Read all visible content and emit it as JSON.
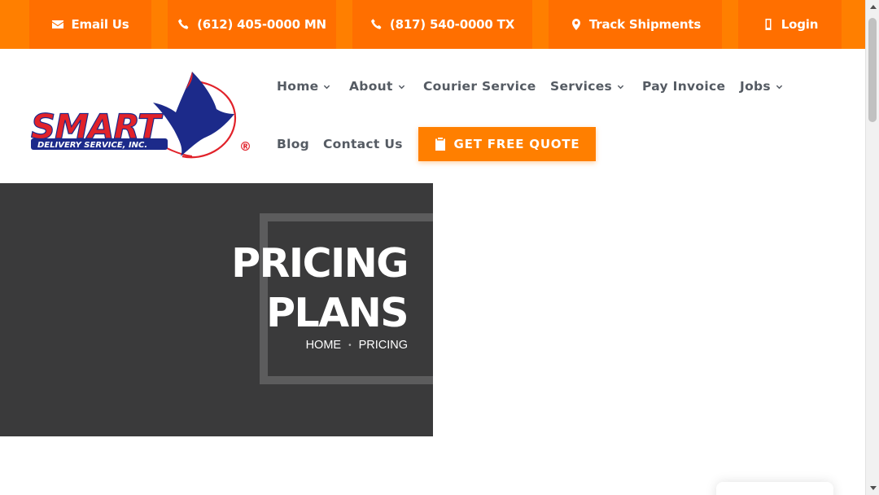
{
  "topbar": {
    "email_label": "Email Us",
    "phone_mn_label": "(612) 405-0000 MN",
    "phone_tx_label": "(817) 540-0000 TX",
    "track_label": "Track Shipments",
    "login_label": "Login"
  },
  "logo": {
    "brand": "SMART",
    "tagline": "DELIVERY SERVICE, INC.",
    "registered": "®"
  },
  "nav": {
    "home": "Home",
    "about": "About",
    "courier": "Courier Service",
    "services": "Services",
    "pay_invoice": "Pay Invoice",
    "jobs": "Jobs",
    "blog": "Blog",
    "contact": "Contact Us",
    "quote_button": "GET FREE QUOTE"
  },
  "hero": {
    "title_line1": "PRICING",
    "title_line2": "PLANS",
    "breadcrumb_home": "HOME",
    "breadcrumb_sep": "•",
    "breadcrumb_current": "PRICING"
  },
  "colors": {
    "brand_orange": "#ff7f00",
    "topbar_item": "#ff6f00",
    "hero_bg": "#3a3a3b",
    "nav_text": "#555b63",
    "logo_red": "#e1222a",
    "logo_navy": "#1c2a8a"
  },
  "icons": {
    "email": "envelope-icon",
    "phone": "phone-icon",
    "track": "map-pin-icon",
    "login": "mobile-icon",
    "quote": "clipboard-icon",
    "dropdown": "chevron-down-icon"
  }
}
